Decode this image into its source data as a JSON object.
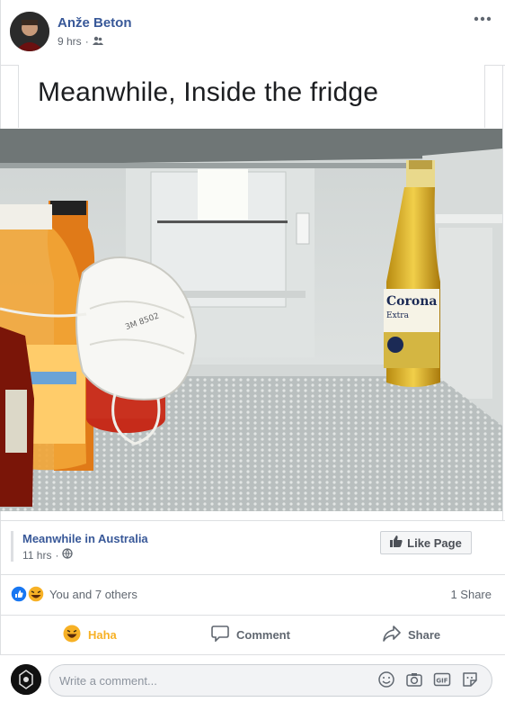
{
  "post": {
    "author": "Anže Beton",
    "time": "9 hrs",
    "audience_icon": "friends-icon",
    "more_icon": "more-dots-icon"
  },
  "shared": {
    "caption": "Meanwhile, Inside the fridge",
    "photo_lettering": "Corona Extra · 3M 8502",
    "page_name": "Meanwhile in Australia",
    "page_time": "11 hrs",
    "page_audience_icon": "globe-icon",
    "like_page_label": "Like Page"
  },
  "reactions": {
    "summary": "You and 7 others",
    "shares": "1 Share",
    "icons": [
      "like-reaction-icon",
      "haha-reaction-icon"
    ]
  },
  "actions": {
    "haha": "Haha",
    "comment": "Comment",
    "share": "Share"
  },
  "composer": {
    "placeholder": "Write a comment...",
    "icons": [
      "emoji-icon",
      "camera-icon",
      "gif-icon",
      "sticker-icon"
    ]
  },
  "colors": {
    "link": "#385898",
    "meta": "#606770",
    "haha": "#f7b125",
    "like": "#1877f2",
    "border": "#dddfe2"
  }
}
